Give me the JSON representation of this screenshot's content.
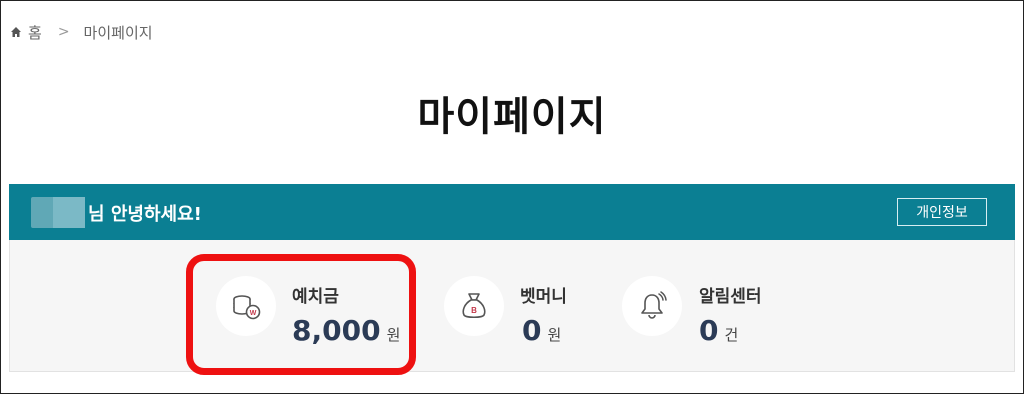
{
  "breadcrumb": {
    "home_label": "홈",
    "separator": ">",
    "current": "마이페이지"
  },
  "page_title": "마이페이지",
  "greeting": {
    "text": "님 안녕하세요!",
    "profile_button_label": "개인정보"
  },
  "summary": {
    "deposit": {
      "label": "예치금",
      "amount": "8,000",
      "unit": "원",
      "icon": "coins-icon"
    },
    "bemoney": {
      "label": "벳머니",
      "amount": "0",
      "unit": "원",
      "icon": "money-bag-icon"
    },
    "notifications": {
      "label": "알림센터",
      "amount": "0",
      "unit": "건",
      "icon": "bell-icon"
    }
  },
  "colors": {
    "accent_bar": "#0b7f93",
    "amount_text": "#2b3b56",
    "highlight": "#ee1111",
    "panel_bg": "#f6f6f6"
  }
}
